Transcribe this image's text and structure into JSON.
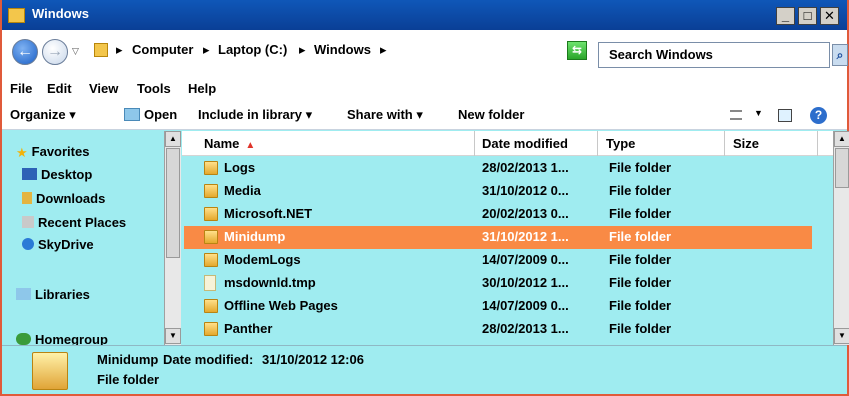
{
  "window": {
    "title": "Windows"
  },
  "address": {
    "crumbs": [
      "Computer",
      "Laptop (C:)",
      "Windows"
    ],
    "separator": "▸",
    "search_placeholder": "Search Windows"
  },
  "menu": [
    "File",
    "Edit",
    "View",
    "Tools",
    "Help"
  ],
  "toolbar": {
    "organize": "Organize ▾",
    "open": "Open",
    "include": "Include in library ▾",
    "share": "Share with ▾",
    "new_folder": "New folder"
  },
  "nav": {
    "favorites": "Favorites",
    "desktop": "Desktop",
    "downloads": "Downloads",
    "recent": "Recent Places",
    "skydrive": "SkyDrive",
    "libraries": "Libraries",
    "homegroup": "Homegroup"
  },
  "columns": {
    "name": "Name",
    "date": "Date modified",
    "type": "Type",
    "size": "Size"
  },
  "files": [
    {
      "name": "Logs",
      "date": "28/02/2013 1...",
      "type": "File folder",
      "icon": "folder-icon"
    },
    {
      "name": "Media",
      "date": "31/10/2012 0...",
      "type": "File folder",
      "icon": "folder-icon"
    },
    {
      "name": "Microsoft.NET",
      "date": "20/02/2013 0...",
      "type": "File folder",
      "icon": "folder-icon"
    },
    {
      "name": "Minidump",
      "date": "31/10/2012 1...",
      "type": "File folder",
      "icon": "folder-icon"
    },
    {
      "name": "ModemLogs",
      "date": "14/07/2009 0...",
      "type": "File folder",
      "icon": "folder-icon"
    },
    {
      "name": "msdownld.tmp",
      "date": "30/10/2012 1...",
      "type": "File folder",
      "icon": "file-icon"
    },
    {
      "name": "Offline Web Pages",
      "date": "14/07/2009 0...",
      "type": "File folder",
      "icon": "folder-icon"
    },
    {
      "name": "Panther",
      "date": "28/02/2013 1...",
      "type": "File folder",
      "icon": "folder-icon"
    }
  ],
  "selected_file": "Minidump",
  "details": {
    "name": "Minidump",
    "date_label": "Date modified:",
    "date": "31/10/2012 12:06",
    "type": "File folder"
  },
  "colors": {
    "selection": "#f98a45",
    "pane_bg": "#9fecf0",
    "titlebar": "#0f57b8"
  }
}
